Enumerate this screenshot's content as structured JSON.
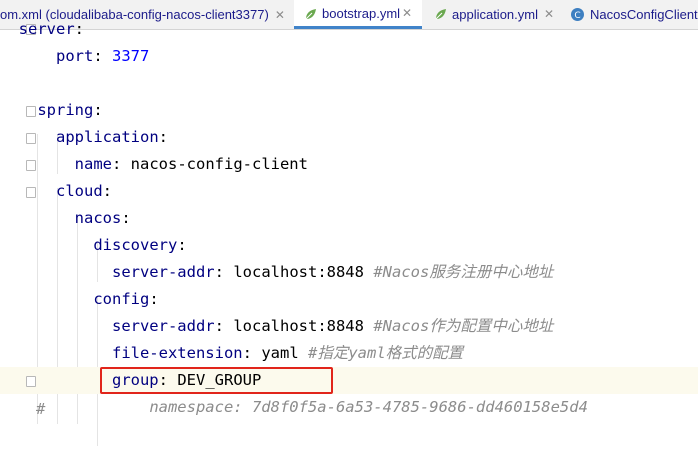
{
  "tabs": [
    {
      "label": "om.xml (cloudalibaba-config-nacos-client3377)",
      "icon": "none",
      "close": "✕",
      "active": false
    },
    {
      "label": "bootstrap.yml",
      "icon": "yaml-leaf-icon",
      "close": "✕",
      "active": true
    },
    {
      "label": "application.yml",
      "icon": "yaml-leaf-icon",
      "close": "✕",
      "active": false
    },
    {
      "label": "NacosConfigClient",
      "icon": "class-icon",
      "close": "",
      "active": false
    }
  ],
  "code": {
    "l0_key": "server",
    "l0_punct": ":",
    "l1_key": "port",
    "l1_punct": ":",
    "l1_val": "3377",
    "l3_key": "spring",
    "l3_punct": ":",
    "l4_key": "application",
    "l4_punct": ":",
    "l5_key": "name",
    "l5_punct": ":",
    "l5_val": "nacos-config-client",
    "l6_key": "cloud",
    "l6_punct": ":",
    "l7_key": "nacos",
    "l7_punct": ":",
    "l8_key": "discovery",
    "l8_punct": ":",
    "l9_key": "server-addr",
    "l9_punct": ":",
    "l9_val": "localhost:8848",
    "l9_cmt": "#Nacos服务注册中心地址",
    "l10_key": "config",
    "l10_punct": ":",
    "l11_key": "server-addr",
    "l11_punct": ":",
    "l11_val": "localhost:8848",
    "l11_cmt": "#Nacos作为配置中心地址",
    "l12_key": "file-extension",
    "l12_punct": ":",
    "l12_val": "yaml",
    "l12_cmt": "#指定yaml格式的配置",
    "l13_key": "group",
    "l13_punct": ":",
    "l13_val": "DEV_GROUP",
    "l14_hash": "#",
    "l14_cmt": "namespace: 7d8f0f5a-6a53-4785-9686-dd460158e5d4"
  },
  "colors": {
    "key": "#000080",
    "number": "#0000ff",
    "comment": "#8c8c8c",
    "highlight_border": "#e1251b",
    "active_tab_underline": "#4083c9"
  }
}
